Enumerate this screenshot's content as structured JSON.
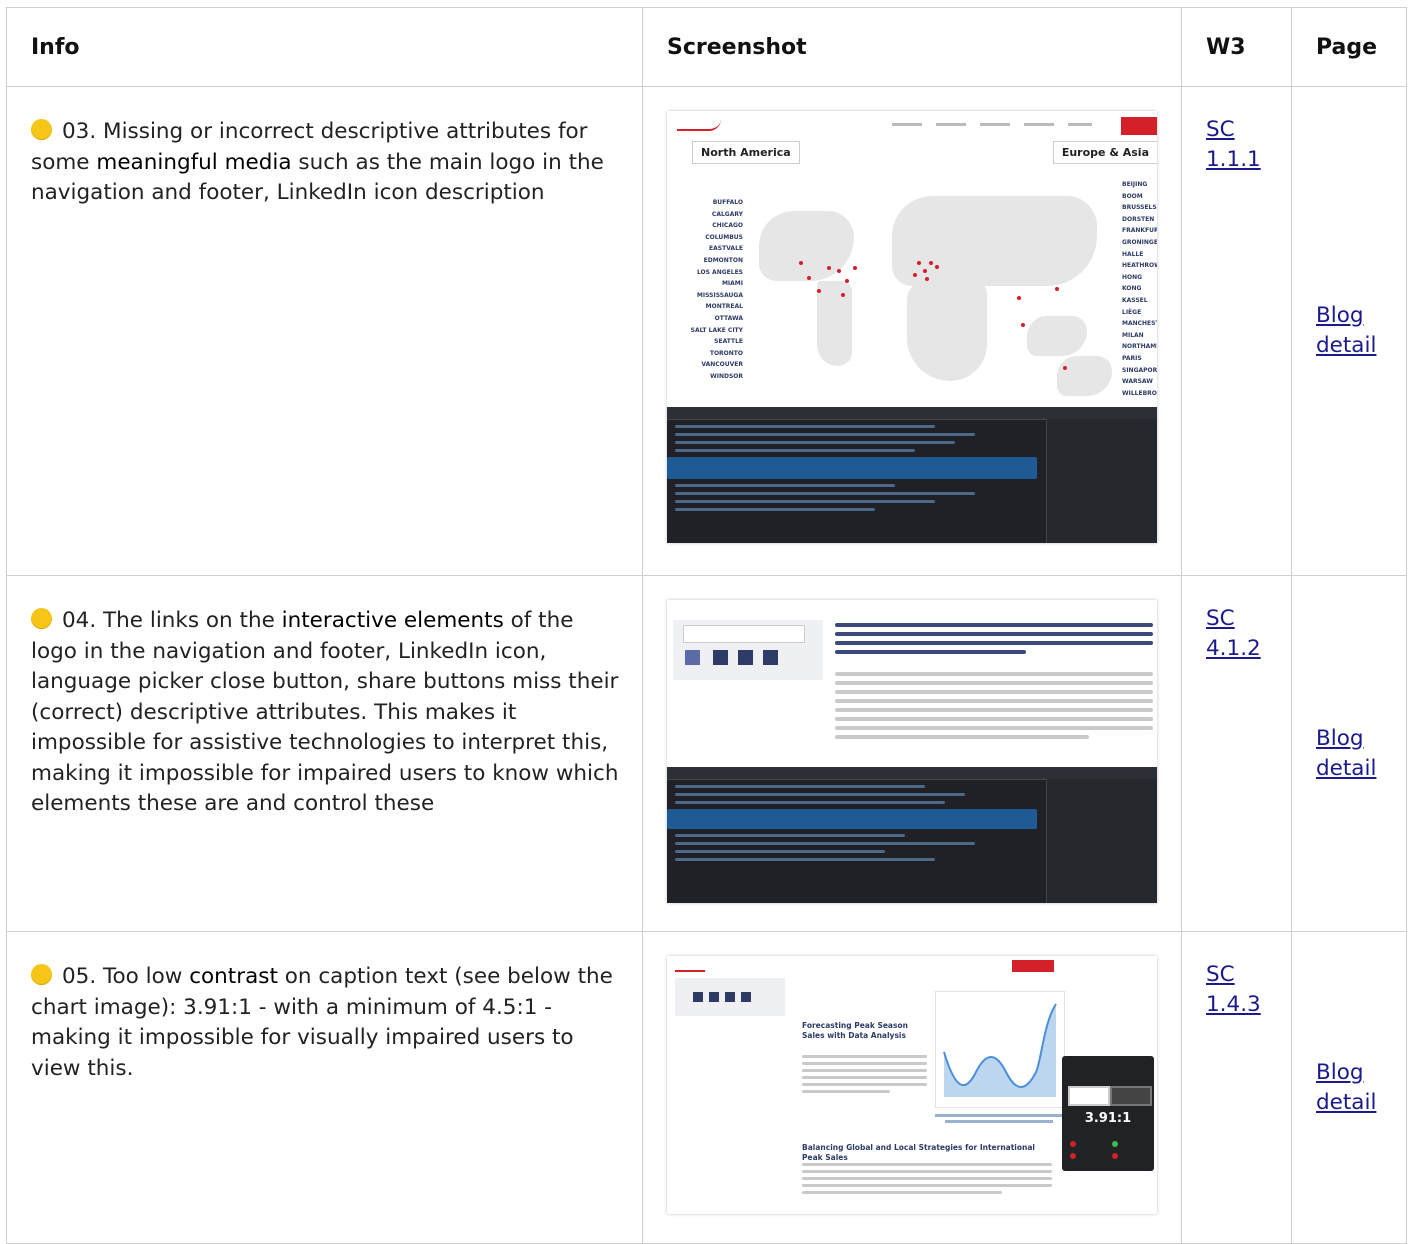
{
  "headers": {
    "info": "Info",
    "screenshot": "Screenshot",
    "w3": "W3",
    "page": "Page"
  },
  "status_color": "#f5c518",
  "rows": [
    {
      "pre": "03. Missing or incorrect descriptive attributes for some ",
      "highlight": "meaningful media",
      "post": " such as the main logo in the navigation and footer, LinkedIn icon description",
      "sc_label": "SC",
      "sc_num": "1.1.1",
      "page_line1": "Blog",
      "page_line2": "detail",
      "shot": {
        "left_tab": "North America",
        "right_tab": "Europe & Asia",
        "left_cities": [
          "BUFFALO",
          "CALGARY",
          "CHICAGO",
          "COLUMBUS",
          "EASTVALE",
          "EDMONTON",
          "LOS ANGELES",
          "MIAMI",
          "MISSISSAUGA",
          "MONTREAL",
          "OTTAWA",
          "SALT LAKE CITY",
          "SEATTLE",
          "TORONTO",
          "VANCOUVER",
          "WINDSOR"
        ],
        "right_cities": [
          "BEIJING",
          "BOOM",
          "BRUSSELS",
          "DORSTEN",
          "FRANKFURT",
          "GRONINGEN",
          "HALLE",
          "HEATHROW",
          "HONG KONG",
          "KASSEL",
          "LIÈGE",
          "MANCHESTER",
          "MILAN",
          "NORTHAMP",
          "PARIS",
          "SINGAPORE",
          "WARSAW",
          "WILLEBROE"
        ]
      }
    },
    {
      "pre": "04. The links on the ",
      "highlight": "interactive elements",
      "post": " of the logo in the navigation and footer, LinkedIn icon, language picker close button, share buttons miss their (correct) descriptive attributes. This makes it impossible for assistive technologies to interpret this, making it impossible for impaired users to know which elements these are and control these",
      "sc_label": "SC",
      "sc_num": "4.1.2",
      "page_line1": "Blog",
      "page_line2": "detail"
    },
    {
      "pre": "05. Too low ",
      "highlight": "contrast",
      "post": " on caption text (see below the chart image): 3.91:1 - with a minimum of 4.5:1 - making it impossible for visually impaired users to view this.",
      "sc_label": "SC",
      "sc_num": "1.4.3",
      "page_line1": "Blog",
      "page_line2": "detail",
      "shot": {
        "heading1": "Forecasting Peak Season Sales with Data Analysis",
        "heading2": "Balancing Global and Local Strategies for International Peak Sales",
        "ratio": "3.91:1"
      }
    }
  ]
}
